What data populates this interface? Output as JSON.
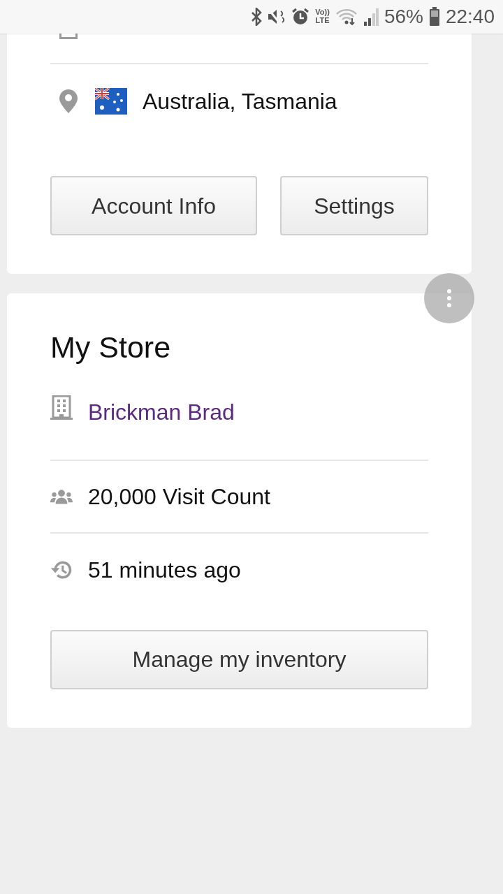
{
  "status_bar": {
    "volte_top": "Vo))",
    "volte_bottom": "LTE",
    "battery": "56%",
    "time": "22:40"
  },
  "profile_card": {
    "rows": [
      {
        "kind": "date"
      },
      {
        "kind": "location",
        "text": "Australia, Tasmania"
      }
    ],
    "buttons": [
      {
        "label": "Account Info"
      },
      {
        "label": "Settings"
      }
    ]
  },
  "store_card": {
    "title": "My Store",
    "rows": [
      {
        "kind": "store",
        "text": "Brickman Brad",
        "link": true
      },
      {
        "kind": "visits",
        "text": "20,000 Visit Count",
        "link": false
      },
      {
        "kind": "history",
        "text": "51 minutes ago",
        "link": false
      }
    ],
    "button": "Manage my inventory"
  }
}
